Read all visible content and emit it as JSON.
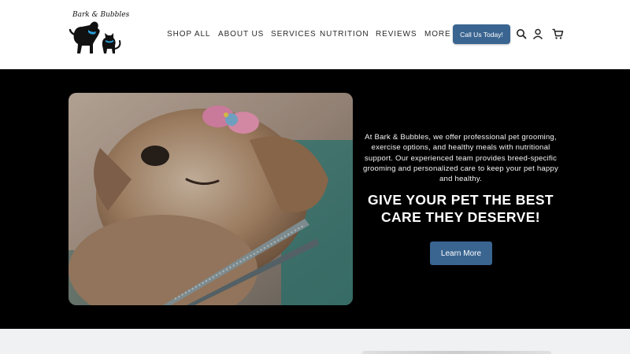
{
  "header": {
    "logo_text": "Bark & Bubbles",
    "nav": [
      {
        "label": "SHOP ALL"
      },
      {
        "label": "ABOUT US"
      },
      {
        "label": "SERVICES"
      },
      {
        "label": "NUTRITION"
      },
      {
        "label": "REVIEWS"
      },
      {
        "label": "MORE"
      }
    ],
    "cta_label": "Call Us Today!",
    "icons": [
      "search-icon",
      "account-icon",
      "cart-icon"
    ]
  },
  "hero": {
    "description": "At Bark & Bubbles, we offer professional pet grooming, exercise options, and healthy meals with nutritional support. Our experienced team provides breed-specific grooming and personalized care to keep your pet happy and healthy.",
    "title": "GIVE YOUR PET THE BEST CARE THEY DESERVE!",
    "button_label": "Learn More"
  },
  "colors": {
    "brand_blue": "#3a6591",
    "hero_bg": "#000000",
    "header_bg": "#ffffff"
  }
}
